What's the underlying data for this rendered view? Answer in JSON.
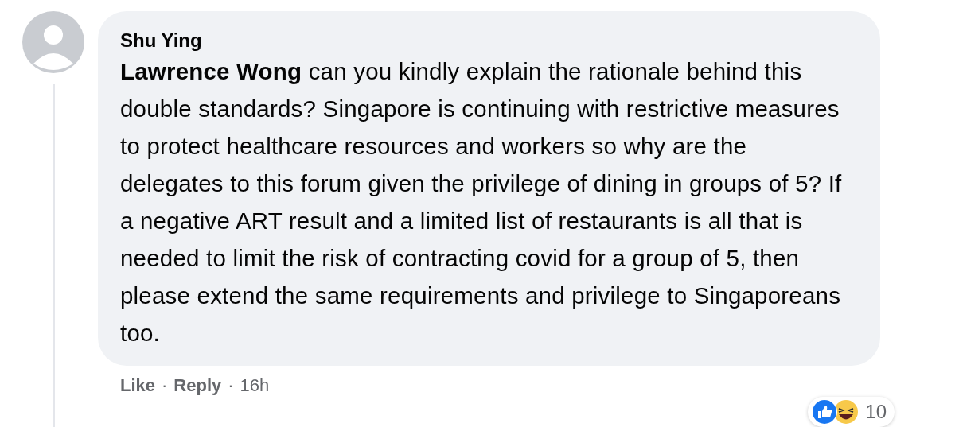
{
  "comment": {
    "author": "Shu Ying",
    "body": "**Lawrence Wong** can you kindly explain the rationale behind this double standards? Singapore is continuing with restrictive measures to protect healthcare resources and workers so why are the delegates to this forum given the privilege of dining in groups of 5? If a negative ART result and a limited list of restaurants is all that is needed to limit the risk of contracting covid for a group of 5, then please extend the same requirements and privilege to Singaporeans too.",
    "reactions": {
      "count": "10"
    },
    "actions": [
      {
        "label": "Like"
      },
      {
        "label": "Reply"
      }
    ],
    "separator": "·",
    "time": "16h"
  }
}
